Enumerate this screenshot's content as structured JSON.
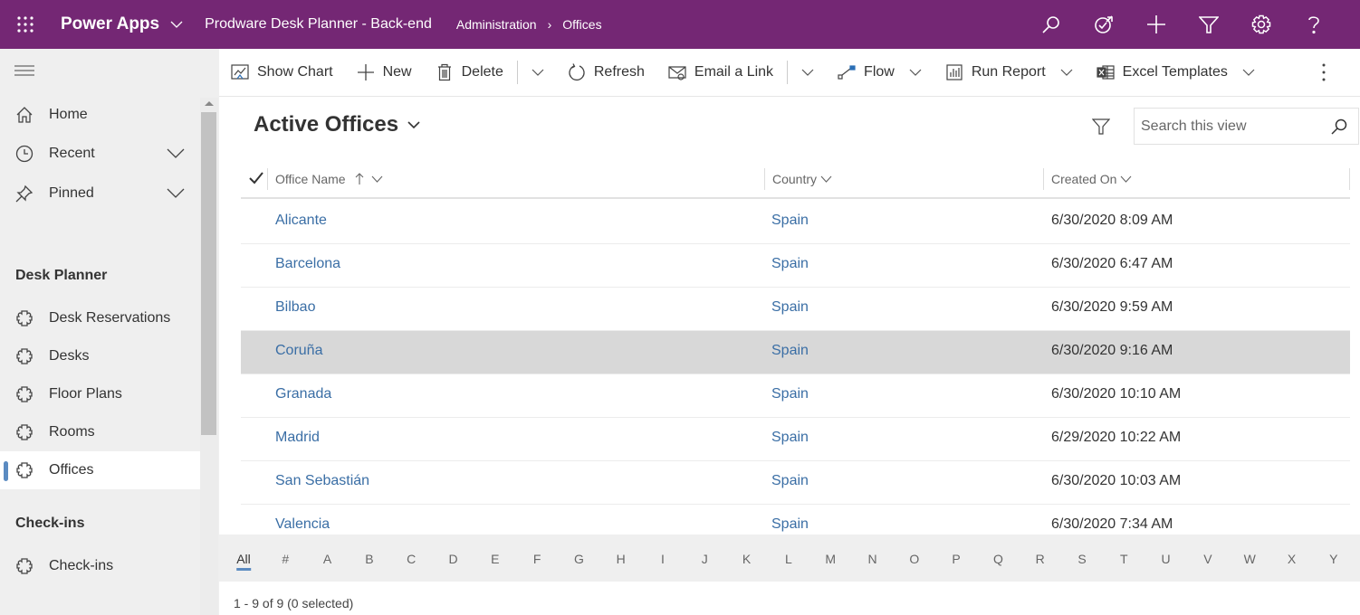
{
  "topbar": {
    "app_name": "Power Apps",
    "environment": "Prodware Desk Planner - Back-end",
    "breadcrumb": [
      "Administration",
      "Offices"
    ],
    "icons": [
      "search-icon",
      "assistant-icon",
      "add-icon",
      "filter-icon",
      "settings-icon",
      "help-icon"
    ],
    "bg_color": "#742774"
  },
  "sidebar": {
    "items_top": [
      {
        "label": "Home",
        "icon": "home-icon"
      },
      {
        "label": "Recent",
        "icon": "clock-icon",
        "expandable": true
      },
      {
        "label": "Pinned",
        "icon": "pin-icon",
        "expandable": true
      }
    ],
    "groups": [
      {
        "title": "Desk Planner",
        "items": [
          {
            "label": "Desk Reservations",
            "icon": "puzzle-icon"
          },
          {
            "label": "Desks",
            "icon": "puzzle-icon"
          },
          {
            "label": "Floor Plans",
            "icon": "puzzle-icon"
          },
          {
            "label": "Rooms",
            "icon": "puzzle-icon"
          },
          {
            "label": "Offices",
            "icon": "puzzle-icon",
            "active": true
          }
        ]
      },
      {
        "title": "Check-ins",
        "items": [
          {
            "label": "Check-ins",
            "icon": "puzzle-icon"
          }
        ]
      }
    ]
  },
  "commandbar": {
    "show_chart": "Show Chart",
    "new": "New",
    "delete": "Delete",
    "refresh": "Refresh",
    "email_link": "Email a Link",
    "flow": "Flow",
    "run_report": "Run Report",
    "excel_templates": "Excel Templates"
  },
  "view": {
    "title": "Active Offices",
    "search_placeholder": "Search this view",
    "columns": [
      "Office Name",
      "Country",
      "Created On"
    ],
    "rows": [
      {
        "name": "Alicante",
        "country": "Spain",
        "created": "6/30/2020 8:09 AM"
      },
      {
        "name": "Barcelona",
        "country": "Spain",
        "created": "6/30/2020 6:47 AM"
      },
      {
        "name": "Bilbao",
        "country": "Spain",
        "created": "6/30/2020 9:59 AM"
      },
      {
        "name": "Coruña",
        "country": "Spain",
        "created": "6/30/2020 9:16 AM",
        "selected": true
      },
      {
        "name": "Granada",
        "country": "Spain",
        "created": "6/30/2020 10:10 AM"
      },
      {
        "name": "Madrid",
        "country": "Spain",
        "created": "6/29/2020 10:22 AM"
      },
      {
        "name": "San Sebastián",
        "country": "Spain",
        "created": "6/30/2020 10:03 AM"
      },
      {
        "name": "Valencia",
        "country": "Spain",
        "created": "6/30/2020 7:34 AM"
      }
    ]
  },
  "jumpbar": [
    "All",
    "#",
    "A",
    "B",
    "C",
    "D",
    "E",
    "F",
    "G",
    "H",
    "I",
    "J",
    "K",
    "L",
    "M",
    "N",
    "O",
    "P",
    "Q",
    "R",
    "S",
    "T",
    "U",
    "V",
    "W",
    "X",
    "Y"
  ],
  "footer": {
    "status": "1 - 9 of 9 (0 selected)"
  }
}
